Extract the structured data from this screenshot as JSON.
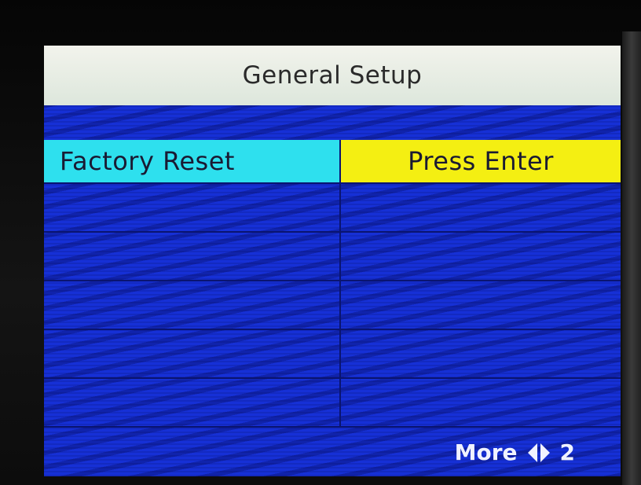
{
  "screen": {
    "title": "General Setup",
    "rows": [
      {
        "label": "Factory Reset",
        "value": "Press Enter",
        "selected": true
      },
      {
        "label": "",
        "value": ""
      },
      {
        "label": "",
        "value": ""
      },
      {
        "label": "",
        "value": ""
      },
      {
        "label": "",
        "value": ""
      },
      {
        "label": "",
        "value": ""
      }
    ],
    "footer": {
      "more_label": "More",
      "nav_icon": "left-right-arrows-icon",
      "page": "2"
    }
  },
  "colors": {
    "background": "#1630d6",
    "title_bar": "#e8ece4",
    "selected_label": "#2ee0ee",
    "selected_value": "#f4ef12"
  }
}
